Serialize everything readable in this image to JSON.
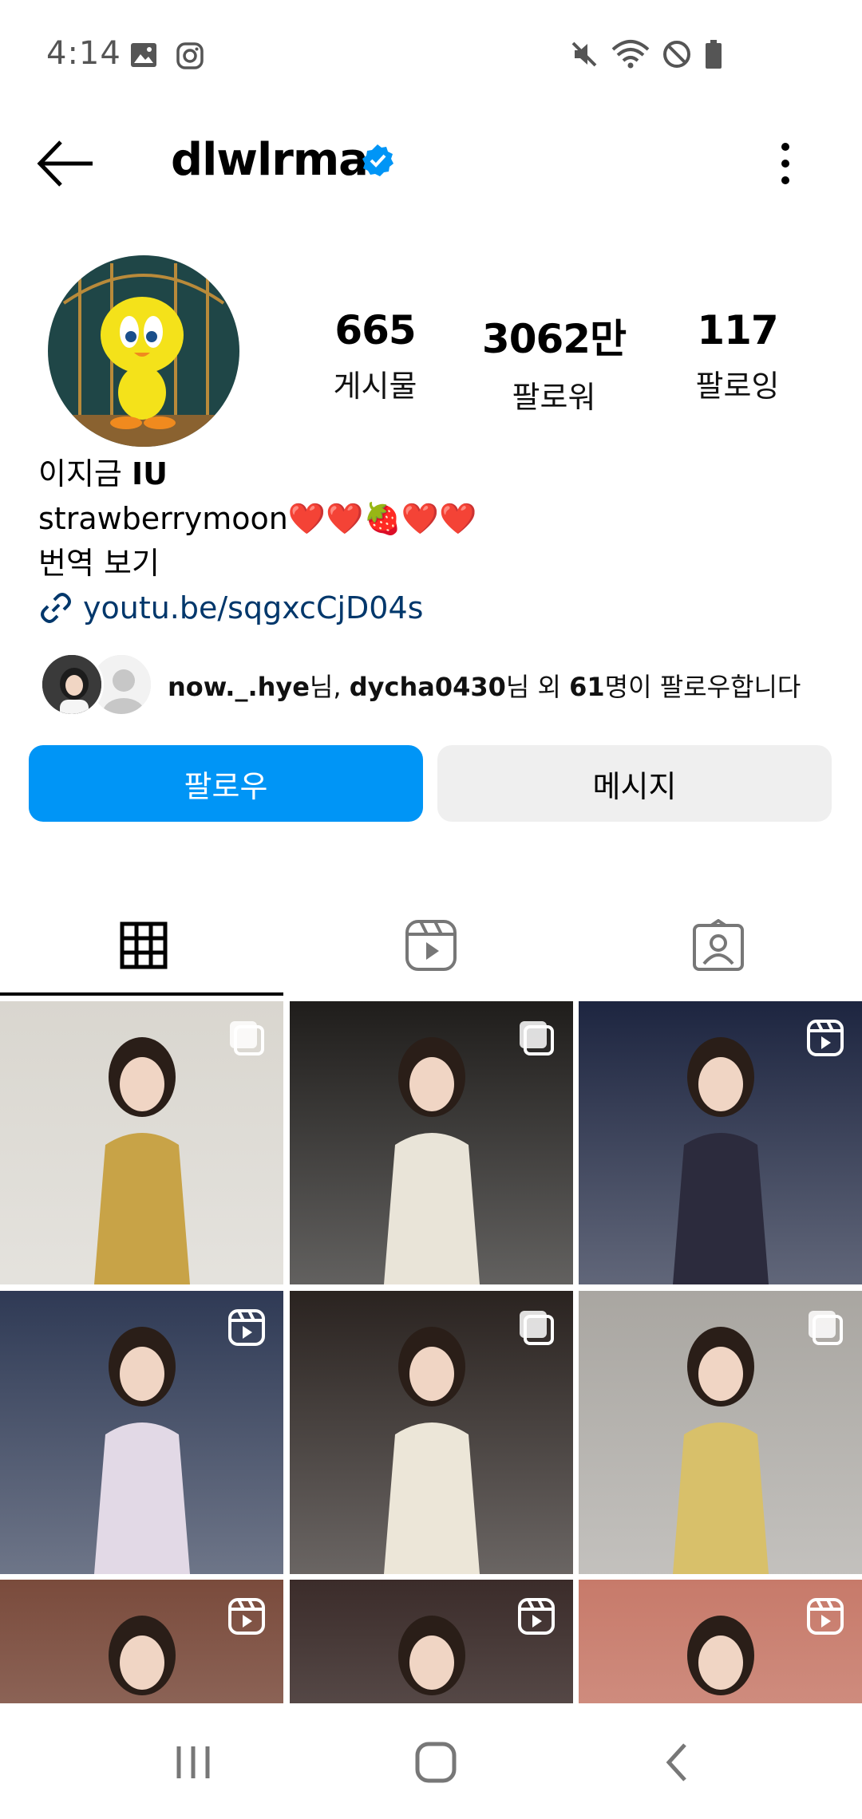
{
  "status_bar": {
    "time": "4:14",
    "left_icons": [
      "gallery-icon",
      "instagram-icon"
    ],
    "right_icons": [
      "mute-icon",
      "wifi-icon",
      "dnd-icon",
      "battery-icon"
    ]
  },
  "header": {
    "username": "dlwlrma",
    "verified": true
  },
  "profile": {
    "stats": [
      {
        "value": "665",
        "label": "게시물"
      },
      {
        "value": "3062만",
        "label": "팔로워"
      },
      {
        "value": "117",
        "label": "팔로잉"
      }
    ],
    "name_prefix": "이지금",
    "name_suffix": "IU",
    "bio_line": "strawberrymoon❤️❤️🍓❤️❤️",
    "translate": "번역 보기",
    "link": "youtu.be/sqgxcCjD04s"
  },
  "followed_by": {
    "user1": "now._.hye",
    "suffix1": "님, ",
    "user2": "dycha0430",
    "suffix2": "님 외 ",
    "count": "61",
    "suffix3": "명이 팔로우합니다"
  },
  "actions": {
    "follow": "팔로우",
    "message": "메시지"
  },
  "tabs": [
    "grid-icon",
    "reels-icon",
    "tagged-icon"
  ],
  "grid": [
    {
      "type": "multi",
      "bg": "#d9d6cf",
      "accent": "#c8a347"
    },
    {
      "type": "multi",
      "bg": "#1f1d1b",
      "accent": "#e9e4d8"
    },
    {
      "type": "reel",
      "bg": "#1d2540",
      "accent": "#2c2b3d"
    },
    {
      "type": "reel",
      "bg": "#2f3a55",
      "accent": "#e2d9e6"
    },
    {
      "type": "multi",
      "bg": "#2a2320",
      "accent": "#ece6d8"
    },
    {
      "type": "multi",
      "bg": "#a9a6a1",
      "accent": "#d8c06a"
    },
    {
      "type": "reel",
      "bg": "#7a4b3c",
      "accent": "#e9d2c2"
    },
    {
      "type": "reel",
      "bg": "#3b2c2a",
      "accent": "#d9b79d"
    },
    {
      "type": "reel",
      "bg": "#c77a6a",
      "accent": "#2a2422"
    }
  ],
  "colors": {
    "follow_button": "#0095f6",
    "link": "#00376b",
    "verified": "#0095f6"
  }
}
